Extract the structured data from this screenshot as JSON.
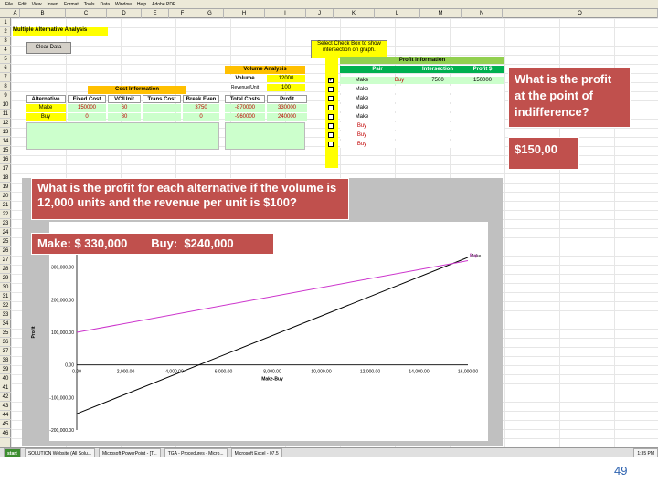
{
  "menubar": {
    "items": [
      "File",
      "Edit",
      "View",
      "Insert",
      "Format",
      "Tools",
      "Data",
      "Window",
      "Help",
      "Adobe PDF"
    ]
  },
  "columns": [
    "A",
    "B",
    "C",
    "D",
    "E",
    "F",
    "G",
    "H",
    "I",
    "J",
    "K",
    "L",
    "M",
    "N",
    "O"
  ],
  "rows": [
    "1",
    "2",
    "3",
    "4",
    "5",
    "6",
    "7",
    "8",
    "9",
    "10",
    "11",
    "12",
    "13",
    "14",
    "15",
    "16",
    "17",
    "18",
    "19",
    "20",
    "21",
    "22",
    "23",
    "24",
    "25",
    "26",
    "27",
    "28",
    "29",
    "30",
    "31",
    "32",
    "33",
    "34",
    "35",
    "36",
    "37",
    "38",
    "39",
    "40",
    "41",
    "42",
    "43",
    "44",
    "45",
    "46"
  ],
  "sheet": {
    "title": "Multiple Alternative Analysis",
    "clear_button": "Clear Data",
    "select_note": "Select Check Box to show intersection on graph.",
    "cost_info": {
      "header": "Cost Information",
      "cols": [
        "Alternative",
        "Fixed Cost",
        "VC/Unit",
        "Trans Cost",
        "Break Even"
      ],
      "rows": [
        [
          "Make",
          "150000",
          "60",
          "",
          "3750"
        ],
        [
          "Buy",
          "0",
          "80",
          "",
          "0"
        ]
      ]
    },
    "volume": {
      "header": "Volume Analysis",
      "volume_label": "Volume",
      "volume_value": "12000",
      "revenue_label": "Revenue/Unit",
      "revenue_value": "100",
      "cols": [
        "Total Costs",
        "Profit"
      ],
      "rows": [
        [
          "-870000",
          "330000"
        ],
        [
          "-960000",
          "240000"
        ]
      ]
    },
    "profit_info": {
      "header": "Profit Information",
      "cols": [
        "Pair",
        "Intersection",
        "Profit $"
      ],
      "rows": [
        [
          "Make",
          "Buy",
          "7500",
          "150000"
        ],
        [
          "Make",
          "",
          "",
          ""
        ],
        [
          "Make",
          "",
          "",
          ""
        ],
        [
          "Make",
          "",
          "",
          ""
        ],
        [
          "Make",
          "",
          "",
          ""
        ],
        [
          "Buy",
          "",
          "",
          ""
        ],
        [
          "Buy",
          "",
          "",
          ""
        ],
        [
          "Buy",
          "",
          "",
          ""
        ]
      ]
    }
  },
  "callouts": {
    "indifference_q": "What is the profit at the point of indifference?",
    "indifference_a": "$150,00",
    "each_q": "What is the profit for each alternative if the volume is 12,000 units and the revenue per unit is $100?",
    "each_make": "Make: $ 330,000",
    "each_buy": "Buy:  $240,000"
  },
  "chart_data": {
    "type": "line",
    "xlabel": "Make-Buy",
    "ylabel": "Profit",
    "xlim": [
      0,
      16000
    ],
    "ylim": [
      -200000,
      400000
    ],
    "xticks": [
      "0.00",
      "2,000.00",
      "4,000.00",
      "6,000.00",
      "8,000.00",
      "10,000.00",
      "12,000.00",
      "14,000.00",
      "16,000.00"
    ],
    "yticks": [
      "-200,000.00",
      "-100,000.00",
      "0.00",
      "100,000.00",
      "200,000.00",
      "300,000.00"
    ],
    "series": [
      {
        "name": "Make",
        "color": "#000000",
        "x": [
          0,
          16000
        ],
        "y": [
          -150000,
          330000
        ]
      },
      {
        "name": "Buy",
        "color": "#cc33cc",
        "x": [
          0,
          16000
        ],
        "y": [
          100000,
          320000
        ]
      }
    ]
  },
  "taskbar": {
    "items": [
      "start",
      "SOLUTION Website (All Solu...",
      "Microsoft PowerPoint - [T...",
      "TGA - Procedures - Micro...",
      "Microsoft Excel - 07.5"
    ],
    "clock": "1:35 PM"
  },
  "page_number": "49"
}
